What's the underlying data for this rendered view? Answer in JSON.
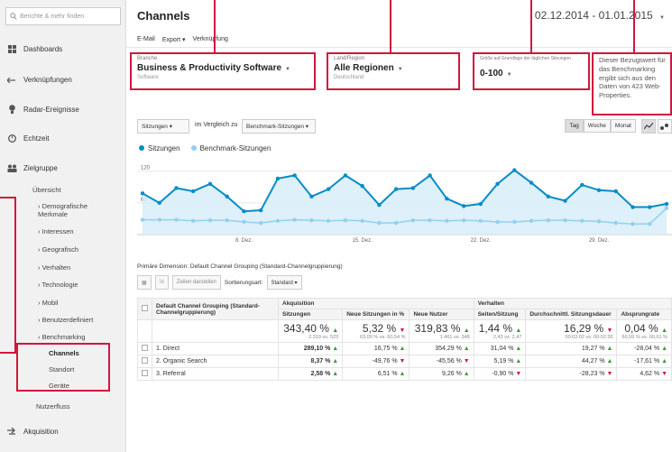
{
  "sidebar": {
    "search_placeholder": "Berichte & mehr finden",
    "items": [
      {
        "label": "Dashboards"
      },
      {
        "label": "Verknüpfungen"
      },
      {
        "label": "Radar-Ereignisse"
      },
      {
        "label": "Echtzeit"
      },
      {
        "label": "Zielgruppe"
      }
    ],
    "zielgruppe_sub": [
      "Übersicht",
      "› Demografische Merkmale",
      "› Interessen",
      "› Geografisch",
      "› Verhalten",
      "› Technologie",
      "› Mobil",
      "› Benutzerdefiniert",
      "› Benchmarking"
    ],
    "benchmark_sub": [
      "Channels",
      "Standort",
      "Geräte"
    ],
    "nutzerfluss": "Nutzerfluss",
    "akquisition": "Akquisition"
  },
  "header": {
    "title": "Channels",
    "date_range": "02.12.2014 - 01.01.2015",
    "toolbar": [
      "E-Mail",
      "Export ▾",
      "Verknüpfung"
    ]
  },
  "fields": {
    "branche": {
      "label": "Branche",
      "value": "Business & Productivity Software",
      "sub": "Software"
    },
    "land": {
      "label": "Land/Region",
      "value": "Alle Regionen",
      "sub": "Deutschland"
    },
    "groesse": {
      "label": "Größe auf Grundlage der täglichen Sitzungen",
      "value": "0-100"
    },
    "info": "Dieser Bezugswert für das Benchmarking ergibt sich aus den Daten von 423 Web-Properties."
  },
  "chart_controls": {
    "metric": "Sitzungen",
    "compare_label": "im Vergleich zu",
    "compare_metric": "Benchmark-Sitzungen",
    "periods": [
      "Tag",
      "Woche",
      "Monat"
    ]
  },
  "chart_data": {
    "type": "area",
    "y_ticks": [
      "120",
      "60"
    ],
    "x_ticks": [
      "8. Dez.",
      "15. Dez.",
      "22. Dez.",
      "29. Dez."
    ],
    "ylim": [
      0,
      140
    ],
    "series": [
      {
        "name": "Sitzungen",
        "color": "#058dc7",
        "values": [
          78,
          60,
          88,
          82,
          96,
          72,
          44,
          46,
          106,
          112,
          72,
          86,
          112,
          92,
          56,
          86,
          88,
          112,
          68,
          54,
          58,
          96,
          122,
          98,
          72,
          64,
          94,
          84,
          82,
          52,
          52,
          58
        ]
      },
      {
        "name": "Benchmark-Sitzungen",
        "color": "#93d0f0",
        "values": [
          28,
          28,
          28,
          26,
          27,
          27,
          24,
          22,
          26,
          28,
          27,
          26,
          27,
          26,
          22,
          22,
          27,
          27,
          26,
          27,
          26,
          24,
          24,
          26,
          27,
          27,
          26,
          25,
          22,
          20,
          20,
          50
        ]
      }
    ]
  },
  "table": {
    "dimension_line": "Primäre Dimension:  Default Channel Grouping (Standard-Channelgruppierung)",
    "toolbar": {
      "sort_label": "Sortierungsart:",
      "sort_value": "Standard ▾",
      "button": "Zeilen darstellen"
    },
    "group_akq": "Akquisition",
    "group_verh": "Verhalten",
    "dim_header": "Default Channel Grouping (Standard-Channelgruppierung)",
    "columns": [
      "Sitzungen",
      "Neue Sitzungen in %",
      "Neue Nutzer",
      "Seiten/Sitzung",
      "Durchschnittl. Sitzungsdauer",
      "Absprungrate"
    ],
    "totals": [
      {
        "v": "343,40 %",
        "dir": "up",
        "s": "2.319 vs. 523"
      },
      {
        "v": "5,32 %",
        "dir": "down",
        "s": "63,00 % vs. 60,54 %"
      },
      {
        "v": "319,83 %",
        "dir": "up",
        "s": "1.461 vs. 348"
      },
      {
        "v": "1,44 %",
        "dir": "up",
        "s": "2,43 vs. 2,47"
      },
      {
        "v": "16,29 %",
        "dir": "down",
        "s": "00:02:02 vs. 00:02:26"
      },
      {
        "v": "0,04 %",
        "dir": "up",
        "s": "60,59 % vs. 60,61 %"
      }
    ],
    "rows": [
      {
        "n": "1.",
        "name": "Direct",
        "cells": [
          [
            "289,10 %",
            "up"
          ],
          [
            "16,75 %",
            "up"
          ],
          [
            "354,29 %",
            "up"
          ],
          [
            "31,04 %",
            "up"
          ],
          [
            "19,27 %",
            "up"
          ],
          [
            "-28,04 %",
            "up"
          ]
        ]
      },
      {
        "n": "2.",
        "name": "Organic Search",
        "cells": [
          [
            "8,37 %",
            "up"
          ],
          [
            "-49,76 %",
            "down"
          ],
          [
            "-45,56 %",
            "down"
          ],
          [
            "5,19 %",
            "up"
          ],
          [
            "44,27 %",
            "up"
          ],
          [
            "-17,61 %",
            "up"
          ]
        ]
      },
      {
        "n": "3.",
        "name": "Referral",
        "cells": [
          [
            "2,58 %",
            "up"
          ],
          [
            "6,51 %",
            "up"
          ],
          [
            "9,26 %",
            "up"
          ],
          [
            "-0,90 %",
            "down"
          ],
          [
            "-28,23 %",
            "down"
          ],
          [
            "4,62 %",
            "down"
          ]
        ]
      }
    ]
  },
  "colors": {
    "accent": "#058dc7",
    "highlight": "#d0173f"
  }
}
